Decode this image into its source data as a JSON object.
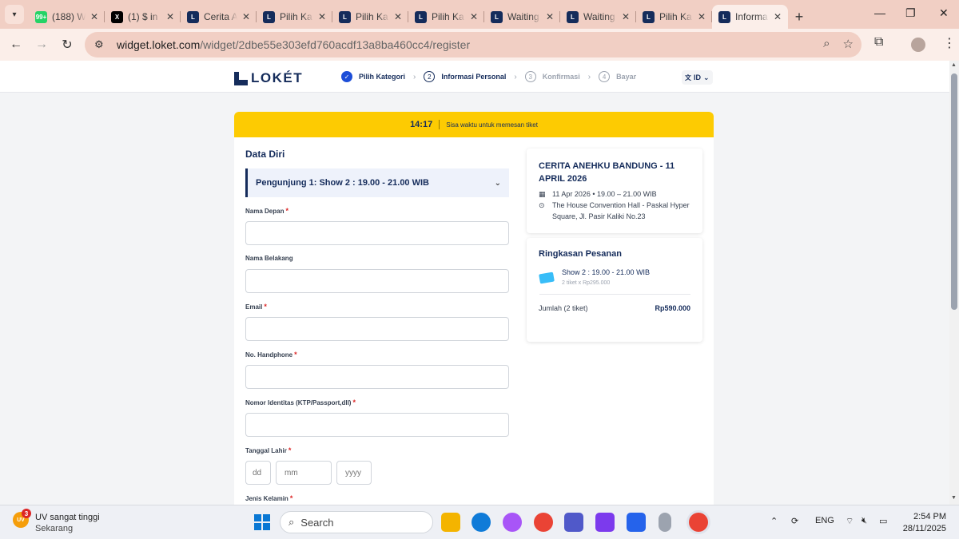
{
  "browser": {
    "tabs": [
      {
        "title": "(188) W",
        "favicon": "whatsapp-icon",
        "color": "#25d366",
        "fav_text": "99+"
      },
      {
        "title": "(1) $ in",
        "favicon": "x-icon",
        "color": "#000000",
        "fav_text": "X"
      },
      {
        "title": "Cerita A",
        "favicon": "loket-icon",
        "color": "#152c5b",
        "fav_text": "L"
      },
      {
        "title": "Pilih Ka",
        "favicon": "loket-icon",
        "color": "#152c5b",
        "fav_text": "L"
      },
      {
        "title": "Pilih Ka",
        "favicon": "loket-icon",
        "color": "#152c5b",
        "fav_text": "L"
      },
      {
        "title": "Pilih Ka",
        "favicon": "loket-icon",
        "color": "#152c5b",
        "fav_text": "L"
      },
      {
        "title": "Waiting",
        "favicon": "loket-icon",
        "color": "#152c5b",
        "fav_text": "L"
      },
      {
        "title": "Waiting",
        "favicon": "loket-icon",
        "color": "#152c5b",
        "fav_text": "L"
      },
      {
        "title": "Pilih Ka",
        "favicon": "loket-icon",
        "color": "#152c5b",
        "fav_text": "L"
      },
      {
        "title": "Informa",
        "favicon": "loket-icon",
        "color": "#152c5b",
        "fav_text": "L",
        "active": true
      }
    ],
    "url_host": "widget.loket.com",
    "url_path": "/widget/2dbe55e303efd760acdf13a8ba460cc4/register"
  },
  "header": {
    "logo_text": "LOKÉT",
    "steps": [
      {
        "num": "✓",
        "label": "Pilih Kategori",
        "state": "done"
      },
      {
        "num": "2",
        "label": "Informasi Personal",
        "state": "current"
      },
      {
        "num": "3",
        "label": "Konfirmasi",
        "state": "inactive"
      },
      {
        "num": "4",
        "label": "Bayar",
        "state": "inactive"
      }
    ],
    "lang": "ID"
  },
  "timer": {
    "time": "14:17",
    "text": "Sisa waktu untuk memesan tiket"
  },
  "form": {
    "section_title": "Data Diri",
    "accordion_label": "Pengunjung 1: Show 2 : 19.00 - 21.00 WIB",
    "fields": {
      "first_name": "Nama Depan",
      "last_name": "Nama Belakang",
      "email": "Email",
      "phone": "No. Handphone",
      "id_number": "Nomor Identitas (KTP/Passport,dll)",
      "birth_date": "Tanggal Lahir",
      "gender": "Jenis Kelamin"
    },
    "required_mark": "*",
    "date_placeholders": {
      "dd": "dd",
      "mm": "mm",
      "yyyy": "yyyy"
    }
  },
  "event": {
    "title": "CERITA ANEHKU BANDUNG - 11 APRIL 2026",
    "datetime": "11 Apr 2026 • 19.00 – 21.00 WIB",
    "venue": "The House Convention Hall - Paskal Hyper Square, Jl. Pasir Kaliki No.23"
  },
  "summary": {
    "title": "Ringkasan Pesanan",
    "ticket_name": "Show 2 : 19.00 - 21.00 WIB",
    "ticket_qty": "2 tiket x Rp295.000",
    "total_label": "Jumlah (2 tiket)",
    "total_amount": "Rp590.000"
  },
  "taskbar": {
    "weather_badge": "3",
    "weather_title": "UV sangat tinggi",
    "weather_sub": "Sekarang",
    "search_placeholder": "Search",
    "lang": "ENG",
    "time": "2:54 PM",
    "date": "28/11/2025"
  }
}
